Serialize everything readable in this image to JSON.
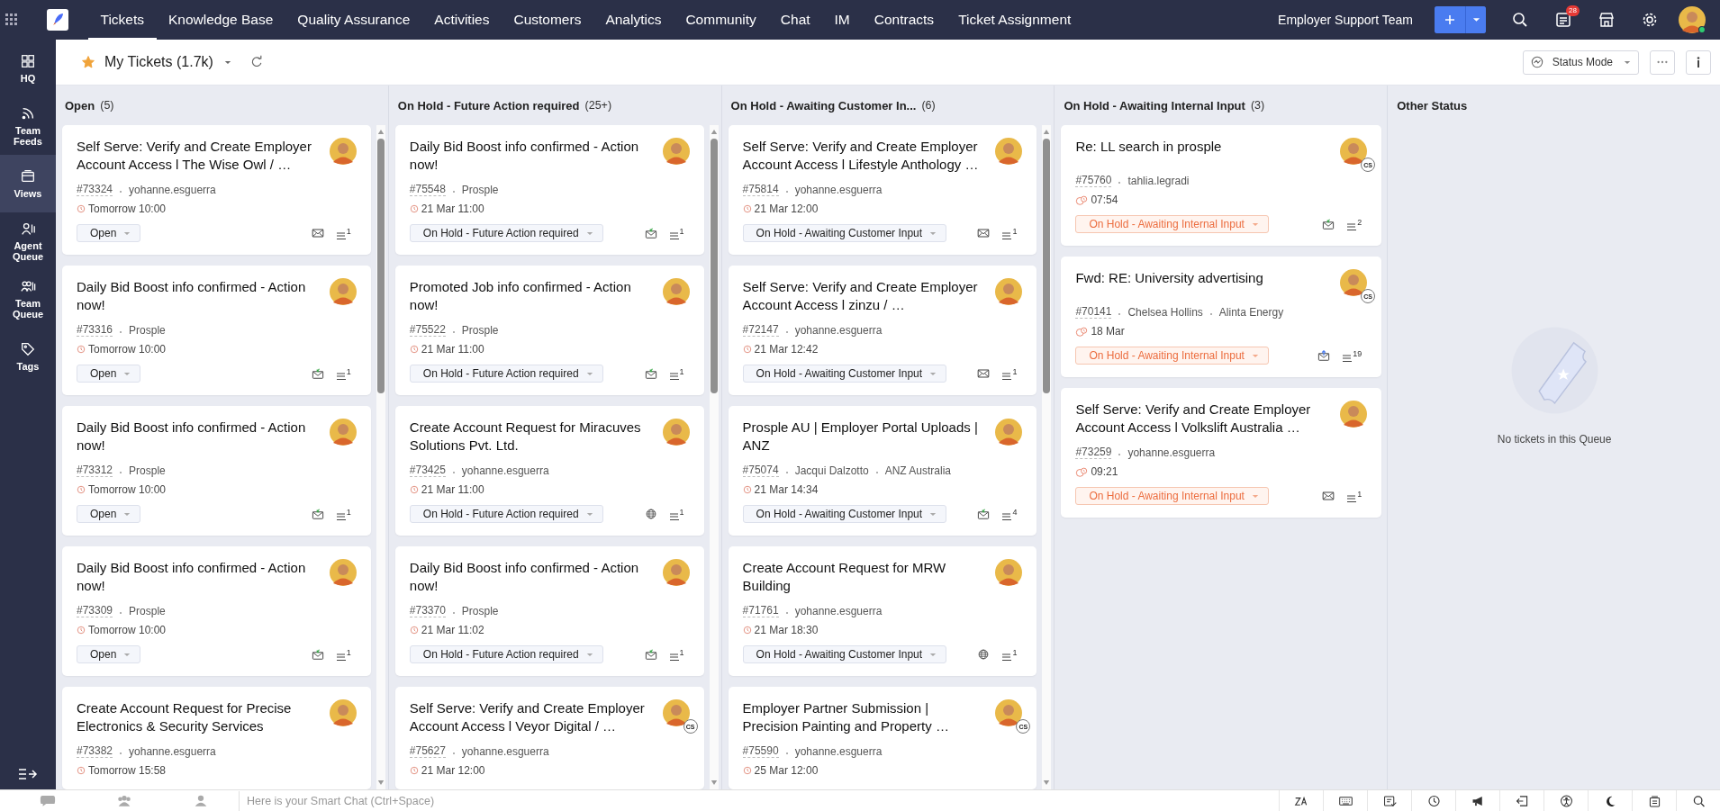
{
  "topbar": {
    "tabs": [
      {
        "label": "Tickets",
        "selected": true
      },
      {
        "label": "Knowledge Base",
        "selected": false
      },
      {
        "label": "Quality Assurance",
        "selected": false
      },
      {
        "label": "Activities",
        "selected": false
      },
      {
        "label": "Customers",
        "selected": false
      },
      {
        "label": "Analytics",
        "selected": false
      },
      {
        "label": "Community",
        "selected": false
      },
      {
        "label": "Chat",
        "selected": false
      },
      {
        "label": "IM",
        "selected": false
      },
      {
        "label": "Contracts",
        "selected": false
      },
      {
        "label": "Ticket Assignment",
        "selected": false
      }
    ],
    "department": "Employer Support Team",
    "notification_count": "28"
  },
  "sidebar": {
    "items": [
      {
        "label": "HQ",
        "selected": false
      },
      {
        "label": "Team Feeds",
        "selected": false
      },
      {
        "label": "Views",
        "selected": true
      },
      {
        "label": "Agent Queue",
        "selected": false
      },
      {
        "label": "Team Queue",
        "selected": false
      },
      {
        "label": "Tags",
        "selected": false
      }
    ]
  },
  "view": {
    "title": "My Tickets (1.7k)",
    "starred": true,
    "mode_button": "Status Mode"
  },
  "columns": [
    {
      "title": "Open",
      "count": "(5)",
      "cards": [
        {
          "title": "Self Serve: Verify and Create Employer Account Access l The Wise Owl / …",
          "id": "#73324",
          "people": [
            "yohanne.esguerra"
          ],
          "overdue": false,
          "time": "Tomorrow 10:00",
          "status": "Open",
          "highlighted": false,
          "channel": {
            "kind": "mail"
          },
          "threads": "1"
        },
        {
          "title": "Daily Bid Boost info confirmed - Action now!",
          "id": "#73316",
          "people": [
            "Prosple"
          ],
          "overdue": false,
          "time": "Tomorrow 10:00",
          "status": "Open",
          "highlighted": false,
          "channel": {
            "kind": "received"
          },
          "threads": "1"
        },
        {
          "title": "Daily Bid Boost info confirmed - Action now!",
          "id": "#73312",
          "people": [
            "Prosple"
          ],
          "overdue": false,
          "time": "Tomorrow 10:00",
          "status": "Open",
          "highlighted": false,
          "channel": {
            "kind": "received"
          },
          "threads": "1"
        },
        {
          "title": "Daily Bid Boost info confirmed - Action now!",
          "id": "#73309",
          "people": [
            "Prosple"
          ],
          "overdue": false,
          "time": "Tomorrow 10:00",
          "status": "Open",
          "highlighted": false,
          "channel": {
            "kind": "received"
          },
          "threads": "1"
        },
        {
          "title": "Create Account Request for Precise Electronics & Security Services",
          "id": "#73382",
          "people": [
            "yohanne.esguerra"
          ],
          "overdue": false,
          "time": "Tomorrow 15:58"
        }
      ]
    },
    {
      "title": "On Hold - Future Action required",
      "count": "(25+)",
      "cards": [
        {
          "title": "Daily Bid Boost info confirmed - Action now!",
          "id": "#75548",
          "people": [
            "Prosple"
          ],
          "overdue": false,
          "time": "21 Mar 11:00",
          "status": "On Hold - Future Action required",
          "highlighted": false,
          "channel": {
            "kind": "received"
          },
          "threads": "1"
        },
        {
          "title": "Promoted Job info confirmed - Action now!",
          "id": "#75522",
          "people": [
            "Prosple"
          ],
          "overdue": false,
          "time": "21 Mar 11:00",
          "status": "On Hold - Future Action required",
          "highlighted": false,
          "channel": {
            "kind": "received"
          },
          "threads": "1"
        },
        {
          "title": "Create Account Request for Miracuves Solutions Pvt. Ltd.",
          "id": "#73425",
          "people": [
            "yohanne.esguerra"
          ],
          "overdue": false,
          "time": "21 Mar 11:00",
          "status": "On Hold - Future Action required",
          "highlighted": false,
          "channel": {
            "kind": "web"
          },
          "threads": "1"
        },
        {
          "title": "Daily Bid Boost info confirmed - Action now!",
          "id": "#73370",
          "people": [
            "Prosple"
          ],
          "overdue": false,
          "time": "21 Mar 11:02",
          "status": "On Hold - Future Action required",
          "highlighted": false,
          "channel": {
            "kind": "received"
          },
          "threads": "1"
        },
        {
          "title": "Self Serve: Verify and Create Employer Account Access l Veyor Digital / …",
          "id": "#75627",
          "people": [
            "yohanne.esguerra"
          ],
          "overdue": false,
          "time": "21 Mar 12:00",
          "badge": "CS"
        }
      ]
    },
    {
      "title": "On Hold - Awaiting Customer In...",
      "count": "(6)",
      "cards": [
        {
          "title": "Self Serve: Verify and Create Employer Account Access l Lifestyle Anthology …",
          "id": "#75814",
          "people": [
            "yohanne.esguerra"
          ],
          "overdue": false,
          "time": "21 Mar 12:00",
          "status": "On Hold - Awaiting Customer Input",
          "highlighted": false,
          "channel": {
            "kind": "mail"
          },
          "threads": "1"
        },
        {
          "title": "Self Serve: Verify and Create Employer Account Access l zinzu / …",
          "id": "#72147",
          "people": [
            "yohanne.esguerra"
          ],
          "overdue": false,
          "time": "21 Mar 12:42",
          "status": "On Hold - Awaiting Customer Input",
          "highlighted": false,
          "channel": {
            "kind": "mail"
          },
          "threads": "1"
        },
        {
          "title": "Prosple AU | Employer Portal Uploads | ANZ",
          "id": "#75074",
          "people": [
            "Jacqui Dalzotto",
            "ANZ Australia"
          ],
          "overdue": false,
          "time": "21 Mar 14:34",
          "status": "On Hold - Awaiting Customer Input",
          "highlighted": false,
          "channel": {
            "kind": "received"
          },
          "threads": "4"
        },
        {
          "title": "Create Account Request for MRW Building",
          "id": "#71761",
          "people": [
            "yohanne.esguerra"
          ],
          "overdue": false,
          "time": "21 Mar 18:30",
          "status": "On Hold - Awaiting Customer Input",
          "highlighted": false,
          "channel": {
            "kind": "web"
          },
          "threads": "1"
        },
        {
          "title": "Employer Partner Submission | Precision Painting and Property …",
          "id": "#75590",
          "people": [
            "yohanne.esguerra"
          ],
          "overdue": false,
          "time": "25 Mar 12:00",
          "badge": "CS"
        }
      ]
    },
    {
      "title": "On Hold - Awaiting Internal Input",
      "count": "(3)",
      "cards": [
        {
          "title": "Re: LL search in prosple",
          "id": "#75760",
          "people": [
            "tahlia.legradi"
          ],
          "overdue": true,
          "time": "07:54",
          "status": "On Hold - Awaiting Internal Input",
          "highlighted": true,
          "channel": {
            "kind": "received"
          },
          "threads": "2",
          "badge": "CS"
        },
        {
          "title": "Fwd: RE: University advertising",
          "id": "#70141",
          "people": [
            "Chelsea Hollins",
            "Alinta Energy"
          ],
          "overdue": true,
          "time": "18 Mar",
          "status": "On Hold - Awaiting Internal Input",
          "highlighted": true,
          "channel": {
            "kind": "sent"
          },
          "threads": "19",
          "badge": "CS"
        },
        {
          "title": "Self Serve: Verify and Create Employer Account Access l Volkslift Australia …",
          "id": "#73259",
          "people": [
            "yohanne.esguerra"
          ],
          "overdue": true,
          "time": "09:21",
          "status": "On Hold - Awaiting Internal Input",
          "highlighted": true,
          "channel": {
            "kind": "mail"
          },
          "threads": "1"
        }
      ]
    },
    {
      "title": "Other Status",
      "empty_message": "No tickets in this Queue"
    }
  ],
  "footer": {
    "chat_placeholder": "Here is your Smart Chat (Ctrl+Space)"
  }
}
